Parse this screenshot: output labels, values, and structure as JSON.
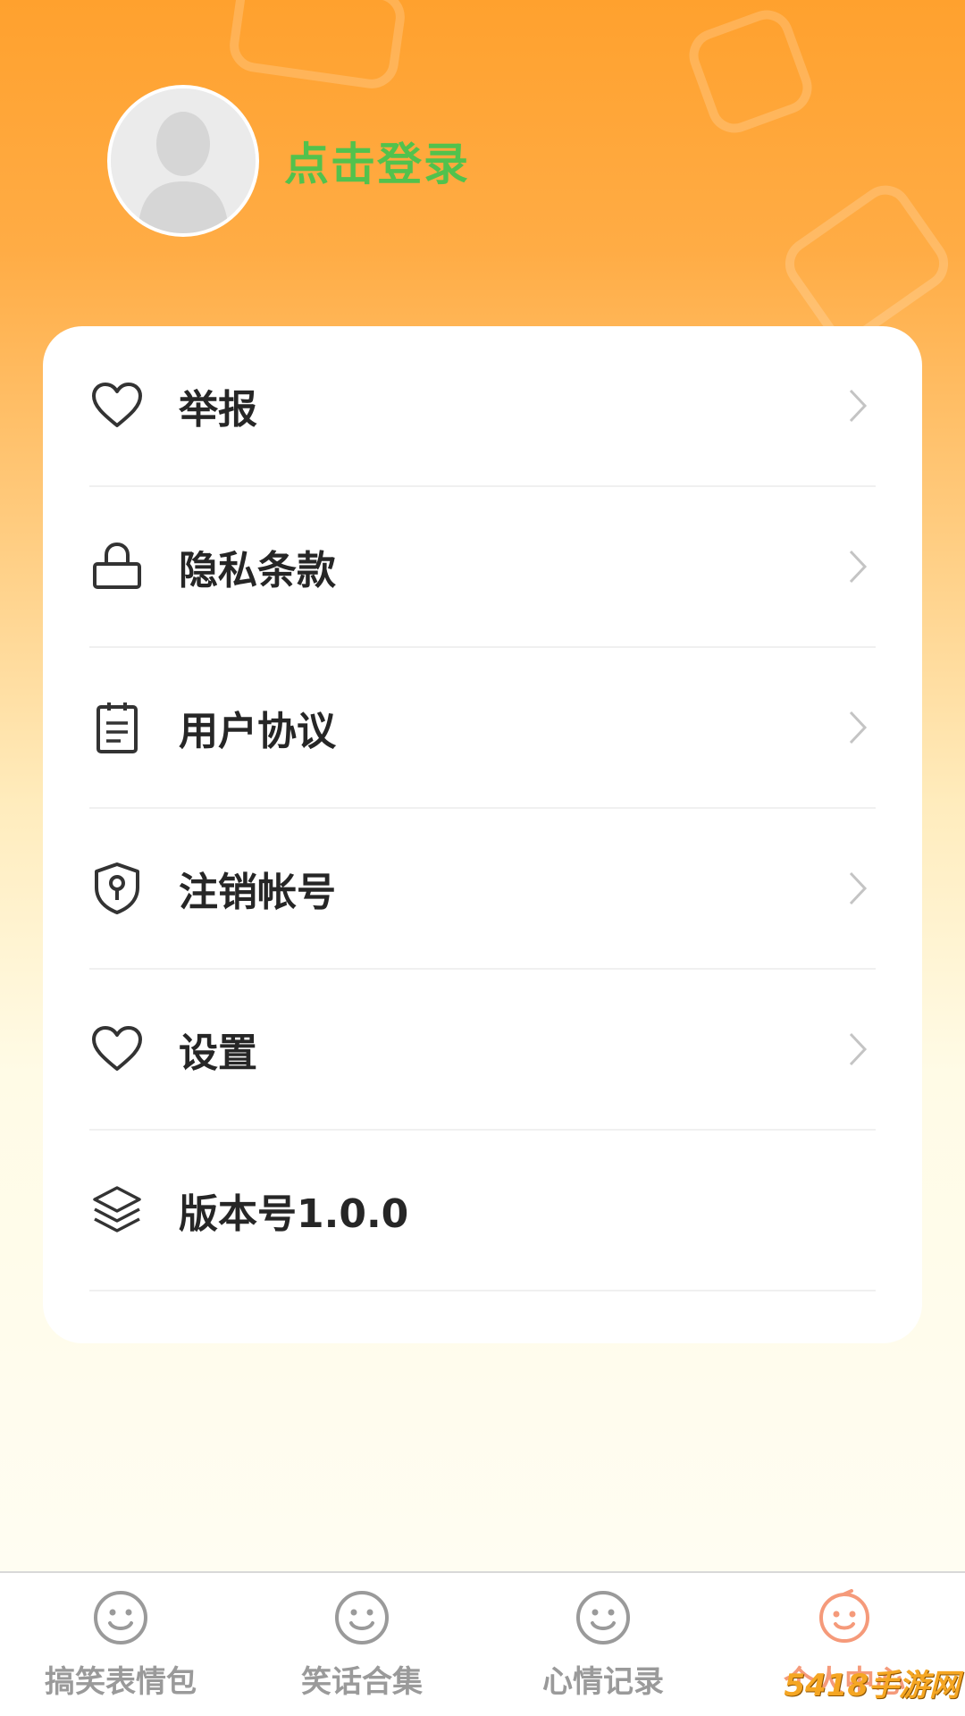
{
  "header": {
    "login_label": "点击登录"
  },
  "menu": {
    "items": [
      {
        "label": "举报",
        "icon": "heart-icon"
      },
      {
        "label": "隐私条款",
        "icon": "lock-icon"
      },
      {
        "label": "用户协议",
        "icon": "document-icon"
      },
      {
        "label": "注销帐号",
        "icon": "shield-icon"
      },
      {
        "label": "设置",
        "icon": "heart-icon"
      },
      {
        "label": "版本号1.0.0",
        "icon": "layers-icon"
      }
    ]
  },
  "tabbar": {
    "tabs": [
      {
        "label": "搞笑表情包",
        "icon": "smiley-icon",
        "active": false
      },
      {
        "label": "笑话合集",
        "icon": "smiley-icon",
        "active": false
      },
      {
        "label": "心情记录",
        "icon": "smiley-icon",
        "active": false
      },
      {
        "label": "个人中心",
        "icon": "smiley-icon",
        "active": true
      }
    ]
  },
  "watermark": {
    "text": "5418手游网"
  },
  "colors": {
    "accent_green": "#52c24d",
    "active_tab": "#f59a7a",
    "inactive_tab": "#9a9a9a",
    "gradient_top": "#ffa12e"
  }
}
